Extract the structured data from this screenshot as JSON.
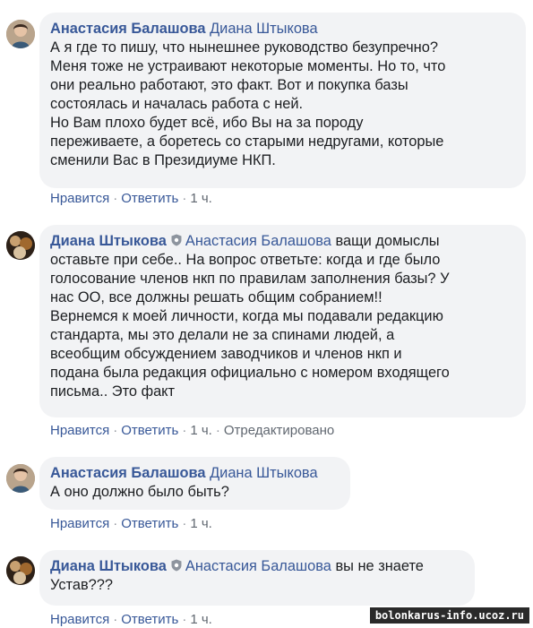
{
  "comments": [
    {
      "author": "Анастасия Балашова",
      "mention": "Диана Штыкова",
      "lines": [
        "А я где то пишу, что нынешнее руководство безупречно?",
        "Меня тоже не устраивают некоторые моменты. Но то, что",
        "они реально работают, это факт. Вот и покупка базы",
        "состоялась и началась работа с ней.",
        "Но Вам плохо будет всё, ибо Вы на за породу",
        "переживаете, а боретесь со старыми недругами, которые",
        "сменили Вас в Президиуме НКП."
      ],
      "like": "Нравится",
      "reply": "Ответить",
      "time": "1 ч."
    },
    {
      "author": "Диана Штыкова",
      "mention": "Анастасия Балашова",
      "first_text": " ващи домыслы",
      "lines": [
        "оставьте при себе.. На вопрос ответьте: когда и где было",
        "голосование членов нкп по правилам заполнения базы? У",
        "нас ОО, все должны решать общим собранием!!",
        "Вернемся к моей личности, когда мы подавали редакцию",
        "стандарта, мы это делали не за спинами людей, а",
        "всеобщим обсуждением заводчиков и членов нкп и",
        "подана была редакция официально с номером входящего",
        "письма.. Это факт"
      ],
      "like": "Нравится",
      "reply": "Ответить",
      "time": "1 ч.",
      "edited": "Отредактировано"
    },
    {
      "author": "Анастасия Балашова",
      "mention": "Диана Штыкова",
      "lines": [
        "А оно должно было быть?"
      ],
      "like": "Нравится",
      "reply": "Ответить",
      "time": "1 ч."
    },
    {
      "author": "Диана Штыкова",
      "mention": "Анастасия Балашова",
      "first_text": " вы не знаете",
      "lines": [
        "Устав???"
      ],
      "like": "Нравится",
      "reply": "Ответить",
      "time": "1 ч."
    }
  ],
  "watermark": "bolonkarus-info.ucoz.ru",
  "colors": {
    "link": "#385898",
    "bubble": "#f2f3f5",
    "meta": "#606770"
  }
}
